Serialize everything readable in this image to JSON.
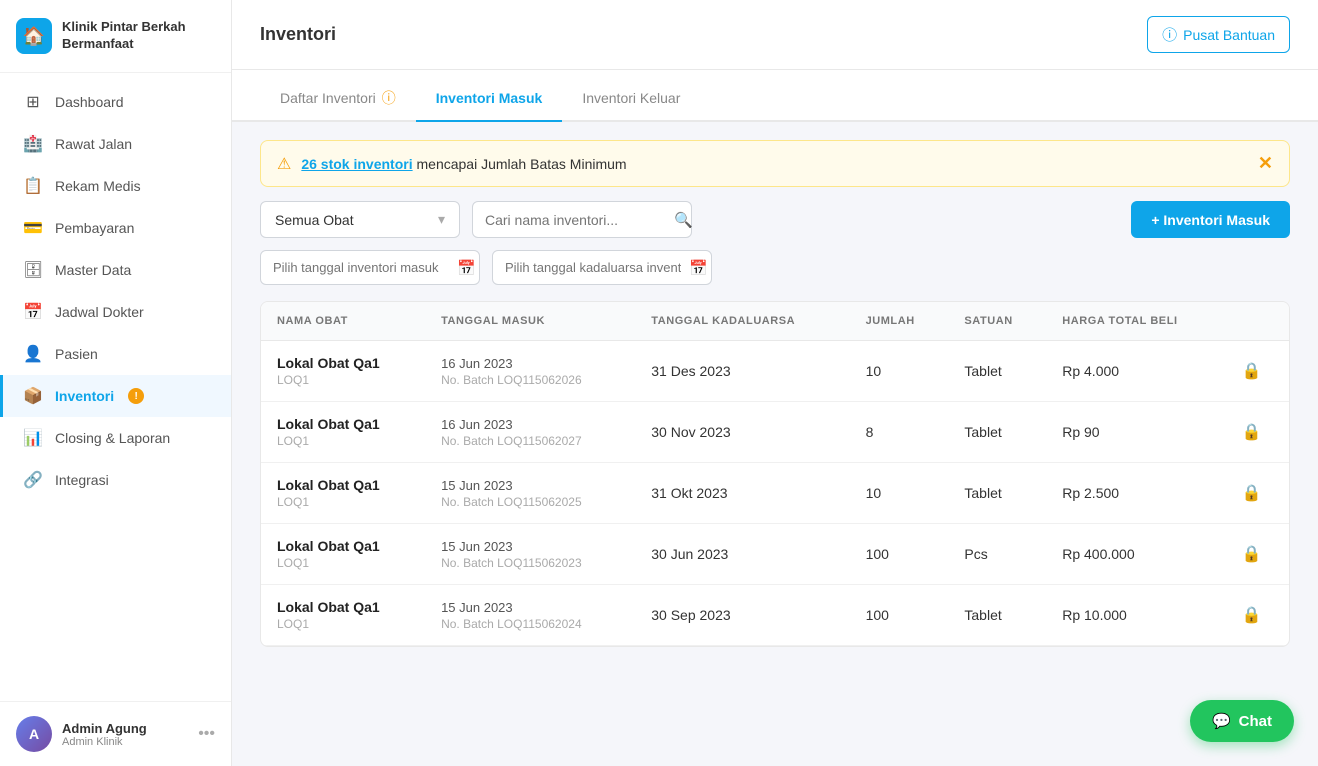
{
  "clinic": {
    "name": "Klinik Pintar Berkah",
    "name2": "Bermanfaat",
    "logo_symbol": "🏠"
  },
  "sidebar": {
    "items": [
      {
        "id": "dashboard",
        "label": "Dashboard",
        "icon": "⊞",
        "active": false
      },
      {
        "id": "rawat-jalan",
        "label": "Rawat Jalan",
        "icon": "🏥",
        "active": false
      },
      {
        "id": "rekam-medis",
        "label": "Rekam Medis",
        "icon": "📋",
        "active": false
      },
      {
        "id": "pembayaran",
        "label": "Pembayaran",
        "icon": "💳",
        "active": false
      },
      {
        "id": "master-data",
        "label": "Master Data",
        "icon": "🗄",
        "active": false
      },
      {
        "id": "jadwal-dokter",
        "label": "Jadwal Dokter",
        "icon": "📅",
        "active": false
      },
      {
        "id": "pasien",
        "label": "Pasien",
        "icon": "👤",
        "active": false
      },
      {
        "id": "inventori",
        "label": "Inventori",
        "icon": "📦",
        "active": true,
        "badge": true
      },
      {
        "id": "closing-laporan",
        "label": "Closing & Laporan",
        "icon": "📊",
        "active": false
      },
      {
        "id": "integrasi",
        "label": "Integrasi",
        "icon": "🔗",
        "active": false
      }
    ]
  },
  "user": {
    "name": "Admin Agung",
    "role": "Admin Klinik",
    "avatar_initials": "A"
  },
  "header": {
    "title": "Inventori",
    "help_label": "Pusat Bantuan"
  },
  "tabs": [
    {
      "id": "daftar-inventori",
      "label": "Daftar Inventori",
      "active": false,
      "has_info": true
    },
    {
      "id": "inventori-masuk",
      "label": "Inventori Masuk",
      "active": true,
      "has_info": false
    },
    {
      "id": "inventori-keluar",
      "label": "Inventori Keluar",
      "active": false,
      "has_info": false
    }
  ],
  "alert": {
    "link_text": "26 stok inventori",
    "message": " mencapai Jumlah Batas Minimum"
  },
  "filters": {
    "category_default": "Semua Obat",
    "search_placeholder": "Cari nama inventori...",
    "date_masuk_placeholder": "Pilih tanggal inventori masuk",
    "date_kadaluarsa_placeholder": "Pilih tanggal kadaluarsa invent..."
  },
  "add_button_label": "+ Inventori Masuk",
  "table": {
    "headers": [
      "NAMA OBAT",
      "TANGGAL MASUK",
      "TANGGAL KADALUARSA",
      "JUMLAH",
      "SATUAN",
      "HARGA TOTAL BELI",
      ""
    ],
    "rows": [
      {
        "name": "Lokal Obat Qa1",
        "code": "LOQ1",
        "date_in": "16 Jun 2023",
        "batch": "No. Batch LOQ115062026",
        "date_exp": "31 Des 2023",
        "qty": "10",
        "unit": "Tablet",
        "price": "Rp 4.000"
      },
      {
        "name": "Lokal Obat Qa1",
        "code": "LOQ1",
        "date_in": "16 Jun 2023",
        "batch": "No. Batch LOQ115062027",
        "date_exp": "30 Nov 2023",
        "qty": "8",
        "unit": "Tablet",
        "price": "Rp 90"
      },
      {
        "name": "Lokal Obat Qa1",
        "code": "LOQ1",
        "date_in": "15 Jun 2023",
        "batch": "No. Batch LOQ115062025",
        "date_exp": "31 Okt 2023",
        "qty": "10",
        "unit": "Tablet",
        "price": "Rp 2.500"
      },
      {
        "name": "Lokal Obat Qa1",
        "code": "LOQ1",
        "date_in": "15 Jun 2023",
        "batch": "No. Batch LOQ115062023",
        "date_exp": "30 Jun 2023",
        "qty": "100",
        "unit": "Pcs",
        "price": "Rp 400.000"
      },
      {
        "name": "Lokal Obat Qa1",
        "code": "LOQ1",
        "date_in": "15 Jun 2023",
        "batch": "No. Batch LOQ115062024",
        "date_exp": "30 Sep 2023",
        "qty": "100",
        "unit": "Tablet",
        "price": "Rp 10.000"
      }
    ]
  },
  "chat": {
    "label": "Chat",
    "icon": "💬"
  }
}
